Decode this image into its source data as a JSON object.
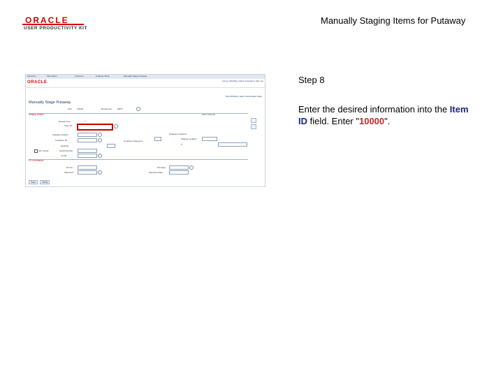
{
  "branding": {
    "logo_text": "ORACLE",
    "logo_subtitle": "USER PRODUCTIVITY KIT",
    "color": "#d40000"
  },
  "document": {
    "title": "Manually Staging Items for Putaway"
  },
  "step": {
    "label": "Step 8",
    "instruction_prefix": "Enter the desired information into the ",
    "field_name": "Item ID",
    "instruction_middle": " field. Enter \"",
    "value": "10000",
    "instruction_suffix": "\"."
  },
  "screenshot": {
    "nav_items": [
      "Favorites",
      "Main Menu",
      "Inventory",
      "Putaway Stock",
      "Manually Stage Putaway"
    ],
    "app_logo": "ORACLE",
    "header_links": "Home | Worklist | Add to Favorites | Sign out",
    "top_links": "New Window | Help | Personalize Page",
    "page_title": "Manually Stage Putaway",
    "unit_label": "Unit:",
    "unit_value": "US001",
    "receipt_no_label": "Receipt No:",
    "receipt_no_value": "NEXT",
    "section_staging": "Staging Details",
    "find_text": "Find | View All",
    "receipt_line_label": "Receipt Line:",
    "receipt_line_value": "1",
    "item_id_label": "*Item ID:",
    "storage_location_label": "Storage Location:",
    "container_id_label": "Container ID:",
    "quantity_label": "Quantity:",
    "item_serial_label": "Item Serial",
    "serial_label": "Serial Number:",
    "lot_label": "Lot ID:",
    "putaway_locations_label": "Putaway Locations",
    "container_sequence_label": "Container Sequence:",
    "staging_location_label": "Staging Location:",
    "staging_value": "0",
    "section_po": "PO Information",
    "po_no_label": "PO No:",
    "po_date_label": "PO Date:",
    "shipment_label": "Shipment:",
    "shipment_date_label": "Shipment Date:",
    "save_button": "Save",
    "notify_button": "Notify"
  }
}
